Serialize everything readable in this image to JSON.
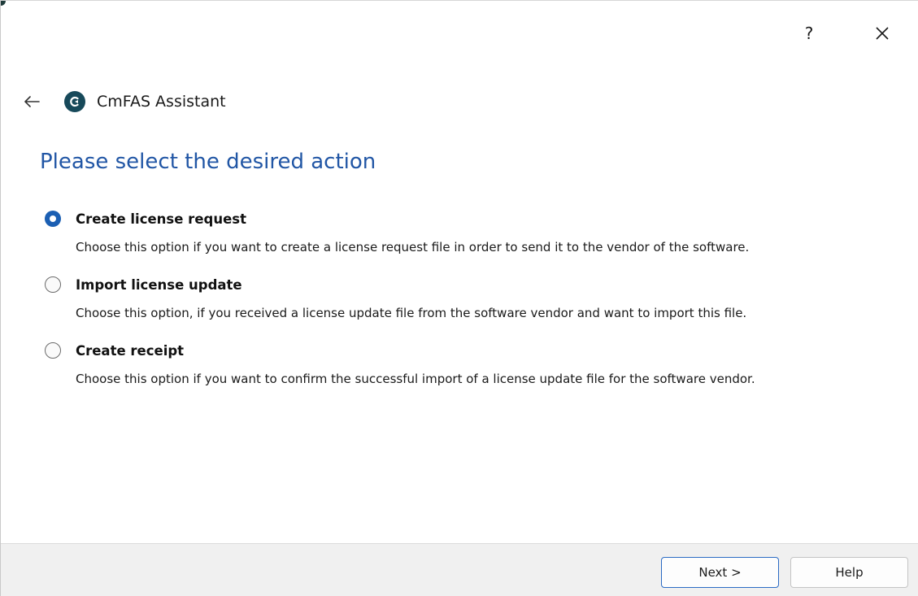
{
  "titlebar": {
    "help_label": "?",
    "close_icon": "close-icon"
  },
  "header": {
    "back_icon": "back-arrow-icon",
    "logo_icon": "cmfas-logo-icon",
    "app_title": "CmFAS Assistant"
  },
  "main": {
    "heading": "Please select the desired action",
    "options": [
      {
        "label": "Create license request",
        "description": "Choose this option if you want to create a license request file in order to send it to the vendor of the software.",
        "selected": true
      },
      {
        "label": "Import license update",
        "description": "Choose this option, if you received a license update file from the software vendor and want to import this file.",
        "selected": false
      },
      {
        "label": "Create receipt",
        "description": "Choose this option if you want to confirm the successful import of a license update file for the software vendor.",
        "selected": false
      }
    ]
  },
  "footer": {
    "next_label": "Next >",
    "help_label": "Help"
  },
  "colors": {
    "heading": "#2156a5",
    "accent": "#1b5fb3",
    "logo": "#17495a"
  }
}
